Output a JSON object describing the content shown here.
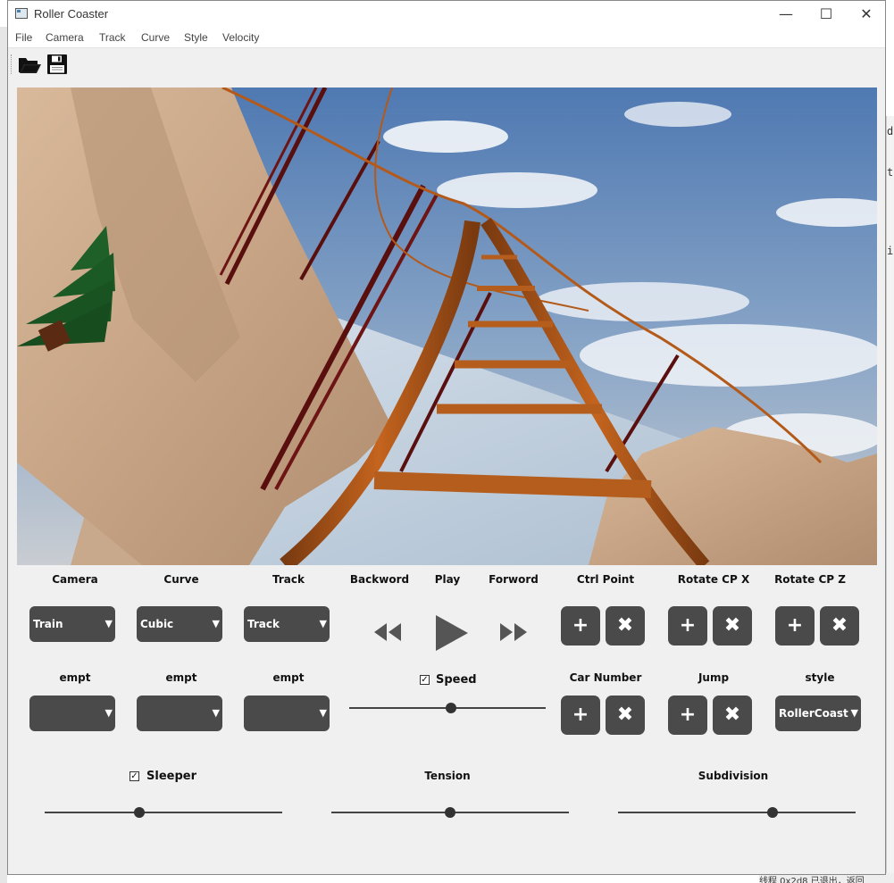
{
  "window": {
    "title": "Roller Coaster",
    "minimize": "—",
    "maximize": "☐",
    "close": "✕"
  },
  "menu": [
    "File",
    "Camera",
    "Track",
    "Curve",
    "Style",
    "Velocity"
  ],
  "toolbar": {
    "open_icon": "folder-open-icon",
    "save_icon": "floppy-disk-icon"
  },
  "viewport": {
    "scene": "3d-roller-coaster-view"
  },
  "top_labels": {
    "camera": "Camera",
    "curve": "Curve",
    "track": "Track",
    "backword": "Backword",
    "play": "Play",
    "forword": "Forword",
    "ctrl_point": "Ctrl Point",
    "rotate_x": "Rotate CP X",
    "rotate_z": "Rotate CP Z"
  },
  "combos_top": {
    "camera": "Train",
    "curve": "Cubic",
    "track": "Track"
  },
  "mid_labels": {
    "empt1": "empt",
    "empt2": "empt",
    "empt3": "empt",
    "speed": "Speed",
    "car_number": "Car Number",
    "jump": "Jump",
    "style": "style"
  },
  "combos_mid": {
    "empt1": "",
    "empt2": "",
    "empt3": "",
    "style": "RollerCoaster"
  },
  "buttons": {
    "plus": "+",
    "remove": "✖"
  },
  "checks": {
    "speed": true,
    "sleeper": true,
    "check_glyph": "✓"
  },
  "bottom_labels": {
    "sleeper": "Sleeper",
    "tension": "Tension",
    "subdivision": "Subdivision"
  },
  "sliders": {
    "speed": 0.52,
    "sleeper": 0.4,
    "tension": 0.5,
    "subdivision": 0.65
  },
  "background": {
    "right_chars": [
      "d",
      "t",
      "i"
    ],
    "bottom_text": "线程 0x2d8 已退出，返回"
  }
}
